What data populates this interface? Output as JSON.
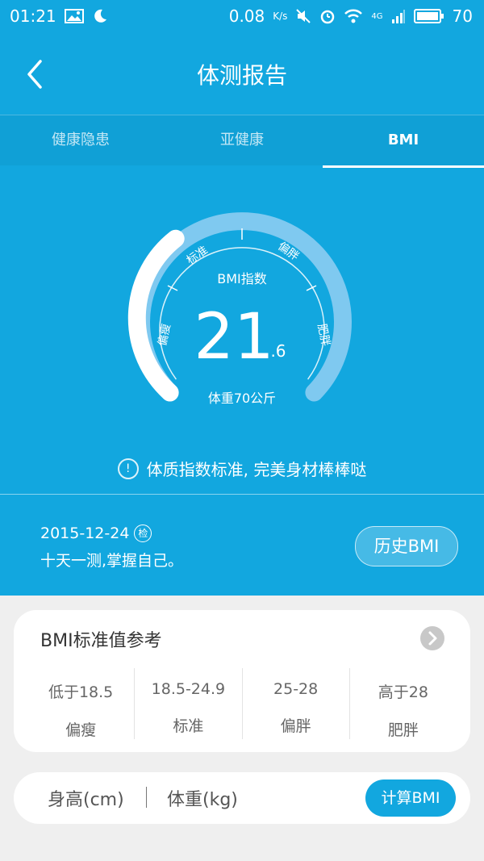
{
  "status_bar": {
    "time": "01:21",
    "net_speed": "0.08",
    "net_unit": "K/s",
    "network": "4G",
    "battery": "70"
  },
  "header": {
    "title": "体测报告"
  },
  "tabs": [
    {
      "label": "健康隐患",
      "active": false
    },
    {
      "label": "亚健康",
      "active": false
    },
    {
      "label": "BMI",
      "active": true
    }
  ],
  "gauge": {
    "label": "BMI指数",
    "value_int": "21",
    "value_dec": ".6",
    "value": 21.6,
    "weight_text": "体重70公斤",
    "zones": [
      "偏瘦",
      "标准",
      "偏胖",
      "肥胖"
    ]
  },
  "hint": {
    "icon": "!",
    "text": "体质指数标准, 完美身材棒棒哒"
  },
  "record": {
    "date": "2015-12-24",
    "badge": "检",
    "slogan": "十天一测,掌握自己。",
    "history_button": "历史BMI"
  },
  "reference": {
    "title": "BMI标准值参考",
    "ranges": [
      {
        "value": "低于18.5",
        "label": "偏瘦"
      },
      {
        "value": "18.5-24.9",
        "label": "标准"
      },
      {
        "value": "25-28",
        "label": "偏胖"
      },
      {
        "value": "高于28",
        "label": "肥胖"
      }
    ]
  },
  "calculator": {
    "height_label": "身高(cm)",
    "weight_label": "体重(kg)",
    "button": "计算BMI"
  },
  "colors": {
    "primary": "#12a7df",
    "gauge_light": "#7fc9f0"
  }
}
